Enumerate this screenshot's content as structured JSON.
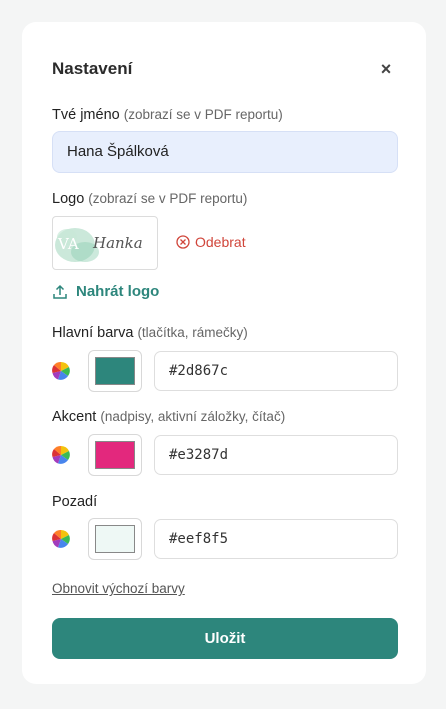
{
  "dialog": {
    "title": "Nastavení",
    "close_label": "×"
  },
  "name_field": {
    "label": "Tvé jméno",
    "hint": "(zobrazí se v PDF reportu)",
    "value": "Hana Špálková"
  },
  "logo": {
    "label": "Logo",
    "hint": "(zobrazí se v PDF reportu)",
    "image_text": "Hanka",
    "image_monogram": "VA",
    "remove_label": "Odebrat",
    "upload_label": "Nahrát logo"
  },
  "colors": {
    "main": {
      "label": "Hlavní barva",
      "hint": "(tlačítka, rámečky)",
      "value": "#2d867c"
    },
    "accent": {
      "label": "Akcent",
      "hint": "(nadpisy, aktivní záložky, čítač)",
      "value": "#e3287d"
    },
    "background": {
      "label": "Pozadí",
      "hint": "",
      "value": "#eef8f5"
    }
  },
  "reset_label": "Obnovit výchozí barvy",
  "save_label": "Uložit",
  "theme": {
    "primary": "#2d867c",
    "danger": "#d0453a",
    "input_bg": "#e8effd"
  }
}
